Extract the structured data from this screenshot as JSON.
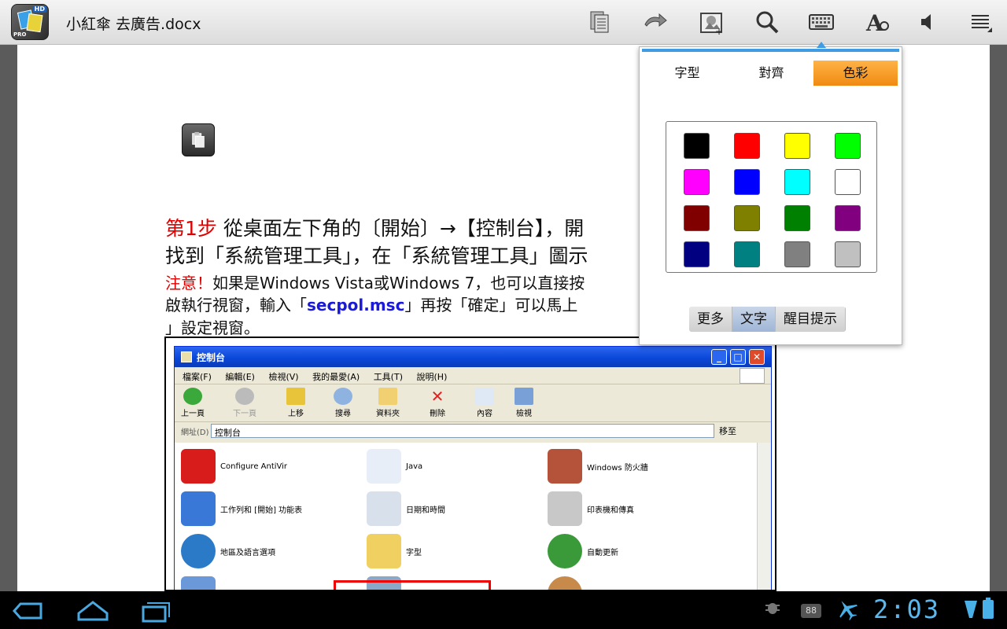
{
  "app": {
    "doc_title": "小紅傘 去廣告.docx",
    "icon_hd": "HD",
    "icon_pro": "PRO"
  },
  "toolbar": {
    "icons": [
      "view-mode-icon",
      "undo-icon",
      "insert-image-icon",
      "search-icon",
      "keyboard-icon",
      "font-format-icon",
      "speaker-icon",
      "menu-icon"
    ]
  },
  "document": {
    "step_label": "第1步",
    "line1_text": " 從桌面左下角的〔開始〕→【控制台】，開",
    "line2_text": "找到「系統管理工具」，在「系統管理工具」圖示",
    "note_label": "注意！",
    "line3_text": "如果是Windows Vista或Windows 7，也可以直接按",
    "line4_pre": "啟執行視窗，輸入「",
    "line4_cmd": "secpol.msc",
    "line4_post": "」再按「確定」可以馬上",
    "line5_text": "」設定視窗。"
  },
  "xp_window": {
    "title": "控制台",
    "menu": [
      "檔案(F)",
      "編輯(E)",
      "檢視(V)",
      "我的最愛(A)",
      "工具(T)",
      "說明(H)"
    ],
    "tools": [
      "上一頁",
      "下一頁",
      "上移",
      "搜尋",
      "資料夾",
      "刪除",
      "內容",
      "檢視"
    ],
    "address_label": "網址(D)",
    "address_value": "控制台",
    "go_label": "移至",
    "items": [
      "Configure AntiVir",
      "Java",
      "Windows 防火牆",
      "工作列和 [開始] 功能表",
      "日期和時間",
      "印表機和傳真",
      "地區及語言選項",
      "字型",
      "自動更新"
    ]
  },
  "popup": {
    "tabs": [
      "字型",
      "對齊",
      "色彩"
    ],
    "active_tab": "色彩",
    "colors": [
      "#000000",
      "#ff0000",
      "#ffff00",
      "#00ff00",
      "#ff00ff",
      "#0000ff",
      "#00ffff",
      "#ffffff",
      "#800000",
      "#808000",
      "#008000",
      "#800080",
      "#000080",
      "#008080",
      "#808080",
      "#c0c0c0"
    ],
    "segments": [
      "更多",
      "文字",
      "醒目提示"
    ],
    "selected_segment": "文字"
  },
  "statusbar": {
    "time": "2:03",
    "icons": [
      "debug-icon",
      "notification-badge-icon",
      "airplane-icon",
      "wifi-icon",
      "battery-icon"
    ],
    "badge_text": "88"
  },
  "navbar": {
    "buttons": [
      "back-button",
      "home-button",
      "recent-apps-button"
    ]
  }
}
